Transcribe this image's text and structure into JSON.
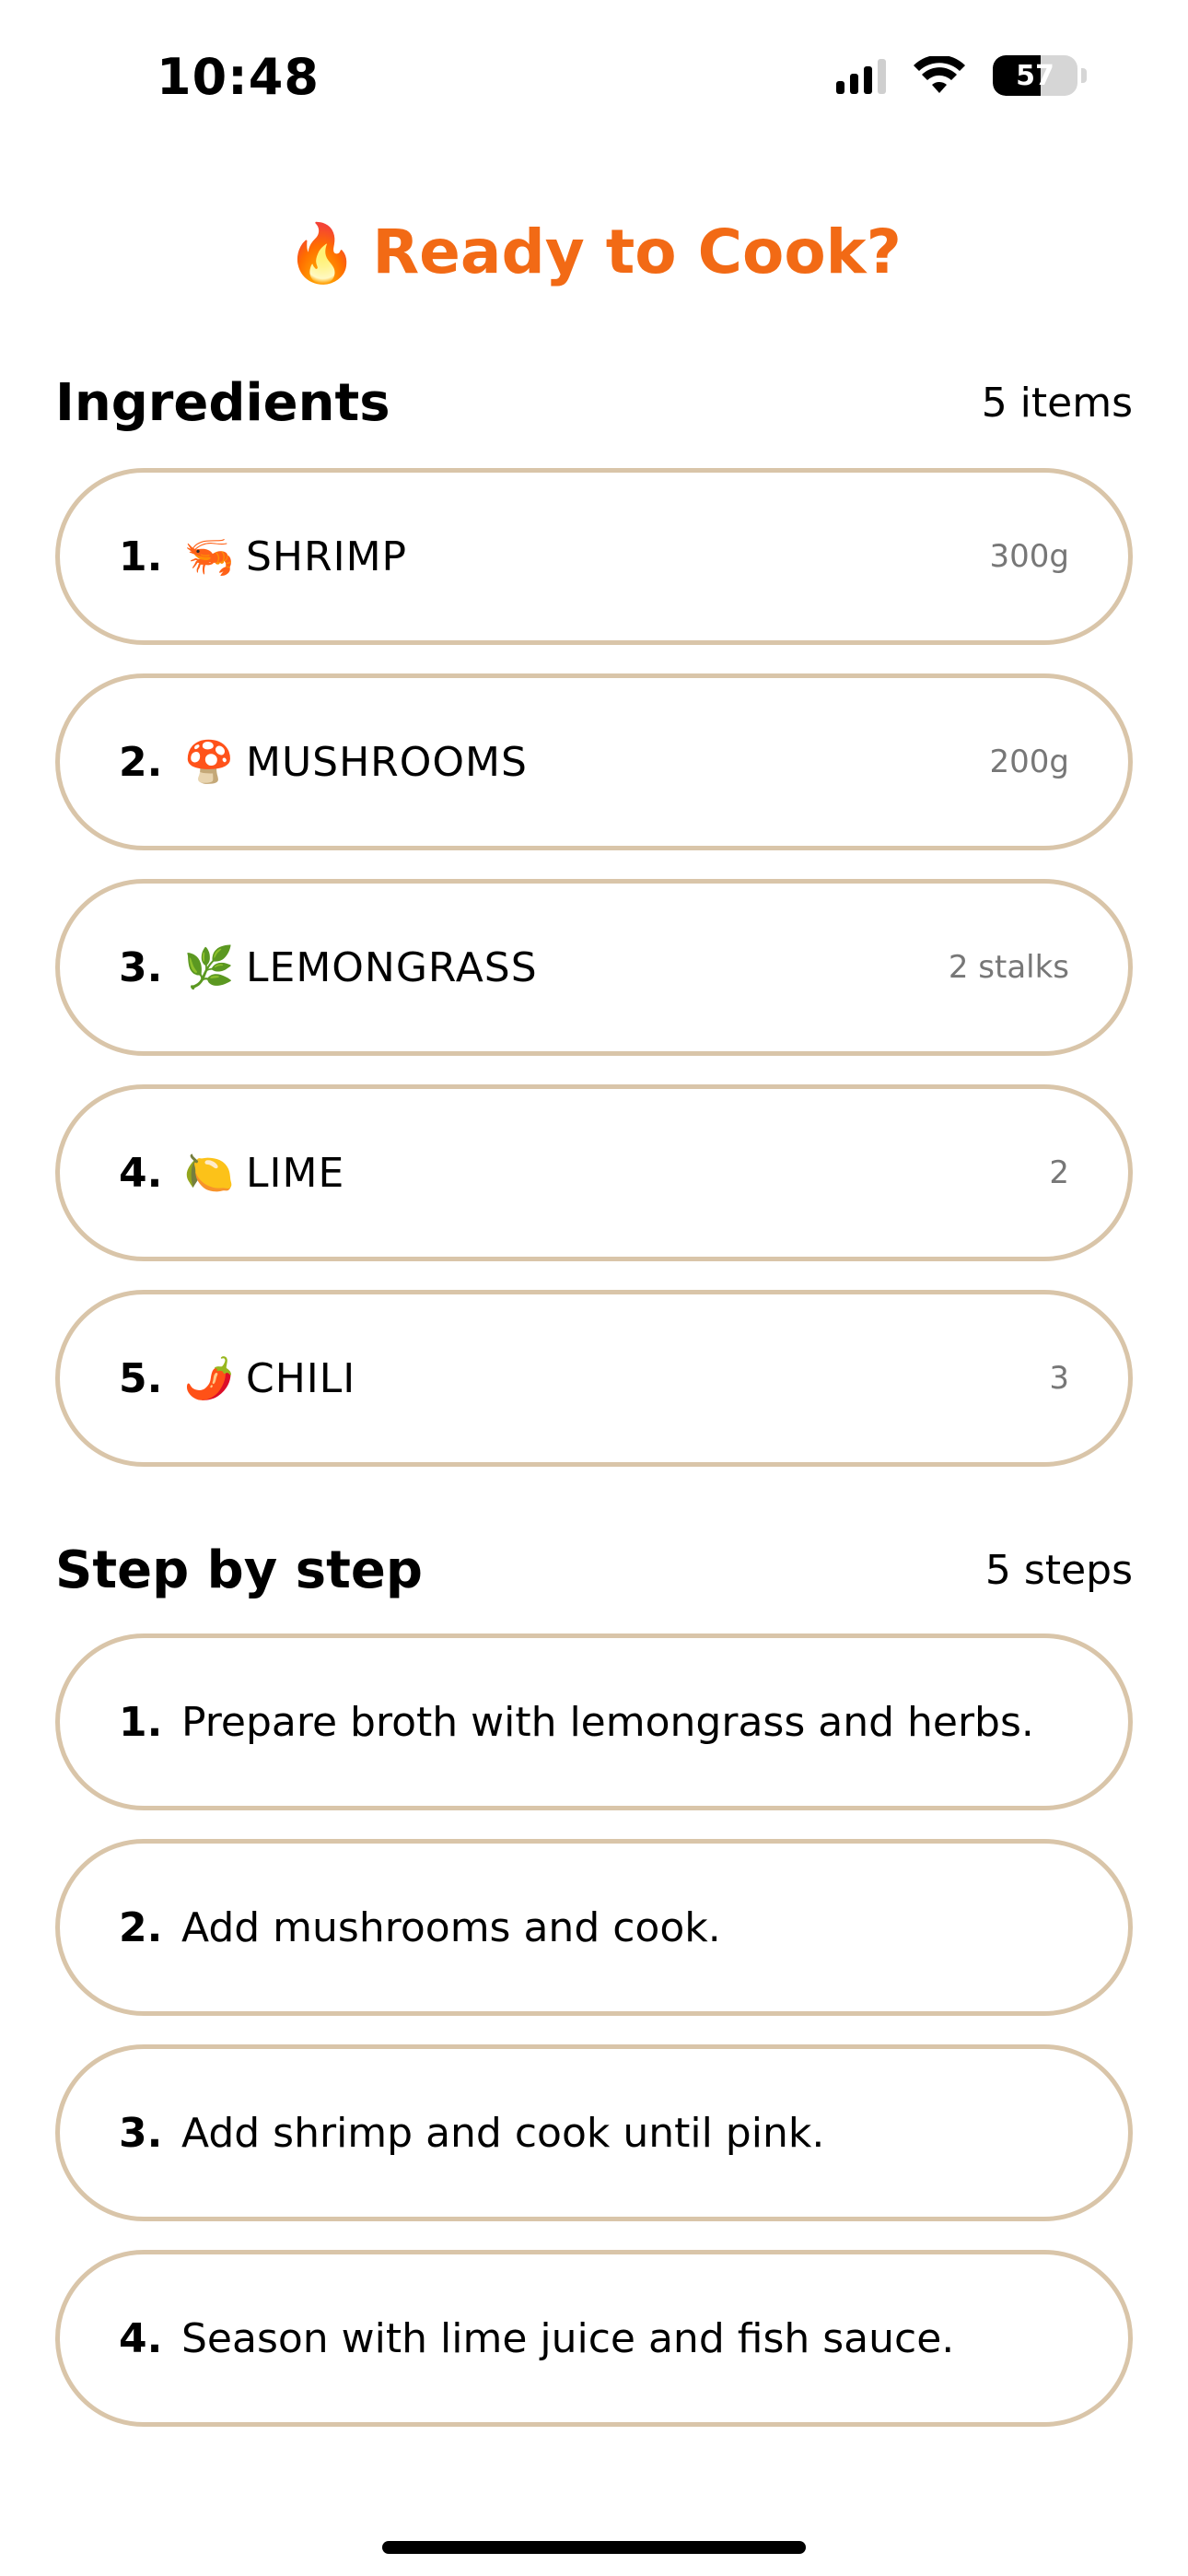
{
  "status_bar": {
    "time": "10:48",
    "battery": "57"
  },
  "title": {
    "emoji": "🔥",
    "text": "Ready to Cook?"
  },
  "ingredients": {
    "heading": "Ingredients",
    "count": "5 items",
    "items": [
      {
        "num": "1.",
        "icon": "🦐",
        "name": "SHRIMP",
        "qty": "300g"
      },
      {
        "num": "2.",
        "icon": "🍄",
        "name": "MUSHROOMS",
        "qty": "200g"
      },
      {
        "num": "3.",
        "icon": "🌿",
        "name": "LEMONGRASS",
        "qty": "2 stalks"
      },
      {
        "num": "4.",
        "icon": "🍋",
        "name": "LIME",
        "qty": "2"
      },
      {
        "num": "5.",
        "icon": "🌶️",
        "name": "CHILI",
        "qty": "3"
      }
    ]
  },
  "steps": {
    "heading": "Step by step",
    "count": "5 steps",
    "items": [
      {
        "num": "1.",
        "text": "Prepare broth with lemongrass and herbs."
      },
      {
        "num": "2.",
        "text": "Add mushrooms and cook."
      },
      {
        "num": "3.",
        "text": "Add shrimp and cook until pink."
      },
      {
        "num": "4.",
        "text": "Season with lime juice and fish sauce."
      }
    ]
  },
  "colors": {
    "accent": "#f26a15",
    "card_border": "#d9c5a9"
  }
}
